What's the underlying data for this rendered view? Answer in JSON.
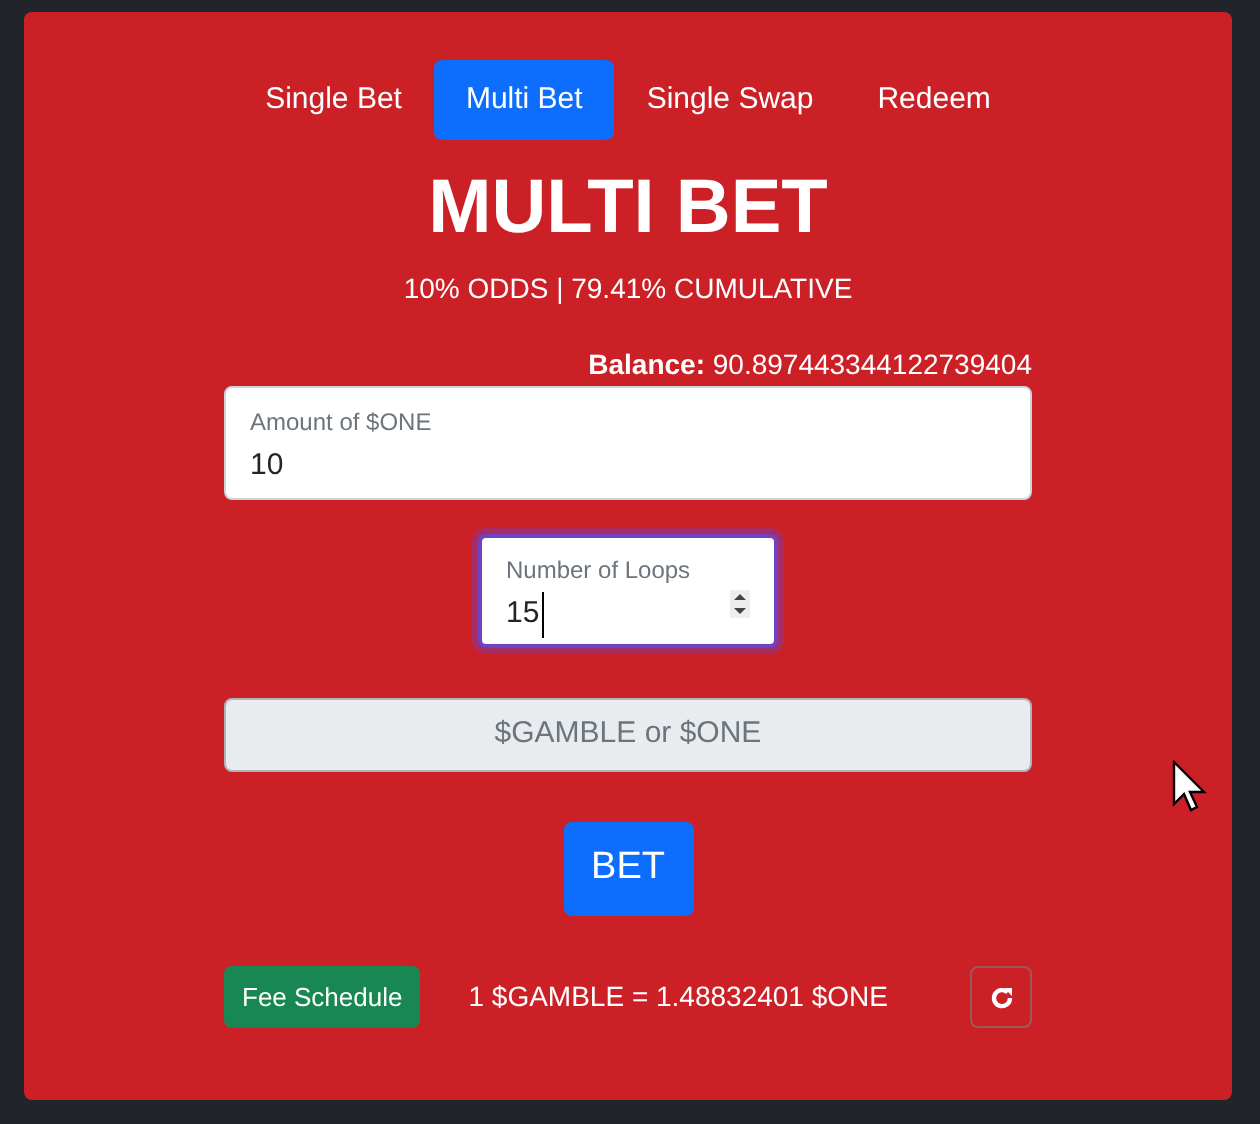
{
  "tabs": [
    {
      "label": "Single Bet",
      "selected": false
    },
    {
      "label": "Multi Bet",
      "selected": true
    },
    {
      "label": "Single Swap",
      "selected": false
    },
    {
      "label": "Redeem",
      "selected": false
    }
  ],
  "title": "MULTI BET",
  "subtitle": "10% ODDS | 79.41% CUMULATIVE",
  "balance": {
    "label": "Balance:",
    "value": "90.897443344122739404"
  },
  "amount": {
    "label": "Amount of $ONE",
    "value": "10"
  },
  "loops": {
    "label": "Number of Loops",
    "value": "15"
  },
  "token_field": {
    "placeholder": "$GAMBLE or $ONE",
    "disabled": true
  },
  "bet_button": "BET",
  "fee_button": "Fee Schedule",
  "rate": "1 $GAMBLE = 1.48832401 $ONE"
}
